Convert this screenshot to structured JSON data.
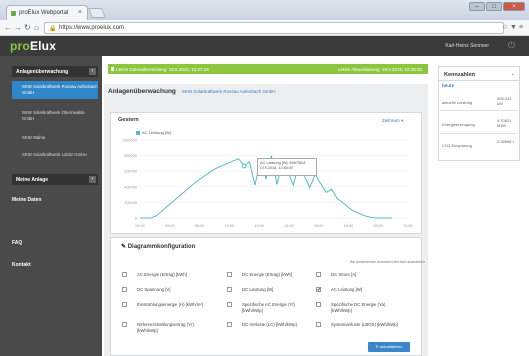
{
  "browser": {
    "tab_title": "proElux Webportal",
    "url": "https://www.proelux.com",
    "window_buttons": [
      "–",
      "□",
      "×"
    ]
  },
  "app": {
    "logo_pre": "pro",
    "logo_post": "Elux",
    "user": "Karl-Heinz Sonnner"
  },
  "sidebar": {
    "sections": [
      {
        "label": "Anlagenüberwachung",
        "toggle": "‹"
      },
      {
        "label": "Meine Anlage",
        "toggle": "›"
      },
      {
        "label": "Meine Daten"
      }
    ],
    "items": [
      {
        "label": "SKW Solarkraftwerk Rossau Aufenbach GmbH",
        "active": true
      },
      {
        "label": "SKW Solarkraftwerk Obernwalde GmbH"
      },
      {
        "label": "SKW Wahla"
      },
      {
        "label": "SKW Solarkraftwerk Lubitz GmbH"
      }
    ],
    "bottom": [
      "FAQ",
      "Kontakt"
    ]
  },
  "notification": {
    "left": "Letzte Datenübermittlung: 19.5.2015, 10:27:16",
    "right": "Letzte Aktualisierung: 19.5.2015, 10:48:30"
  },
  "page": {
    "title": "Anlagenüberwachung",
    "subtitle": "SKW Solarkraftwerk Rossau Aufenbach GmbH"
  },
  "chart_card": {
    "title": "Gestern",
    "zeitraum": "Zeitraum ▾",
    "tooltip_line1": "AC Leistung [W]: 668798.8",
    "tooltip_line2": "Di 5.2015, 12:50:00"
  },
  "chart_data": {
    "type": "line",
    "series": [
      {
        "name": "AC Leistung [W]",
        "color": "#5bb8c8"
      }
    ],
    "x": [
      "04:00",
      "06:00",
      "08:00",
      "10:00",
      "12:00",
      "14:00",
      "16:00",
      "18:00",
      "20:00",
      "22:00"
    ],
    "ylim": [
      0,
      1000000
    ],
    "yticks": [
      "0",
      "200000",
      "400000",
      "600000",
      "800000",
      "1000000"
    ],
    "values": [
      0,
      0,
      0,
      30000,
      90000,
      150000,
      210000,
      270000,
      330000,
      390000,
      450000,
      500000,
      550000,
      600000,
      640000,
      670000,
      700000,
      730000,
      760000,
      668798,
      720000,
      420000,
      760000,
      500000,
      800000,
      430000,
      710000,
      600000,
      420000,
      680000,
      540000,
      390000,
      560000,
      440000,
      330000,
      370000,
      250000,
      200000,
      140000,
      90000,
      60000,
      30000,
      10000,
      0,
      0,
      0,
      0
    ]
  },
  "config": {
    "title": "Diagrammkonfiguration",
    "hint": "Bei bestehender Auswahl mehrfach auswählen",
    "options": [
      {
        "label": "AC Energie (Ertrag) [kWh]",
        "checked": false
      },
      {
        "label": "DC Energie (Ertrag) [kWh]",
        "checked": false
      },
      {
        "label": "DC Strom [A]",
        "checked": false
      },
      {
        "label": "DC Spannung [V]",
        "checked": false
      },
      {
        "label": "DC Leistung [W]",
        "checked": false
      },
      {
        "label": "AC Leistung [W]",
        "checked": true
      },
      {
        "label": "Einstrahlungsenergie (H) [kWh/m²]",
        "checked": false
      },
      {
        "label": "Spezifische AC Energie (Yf) [kWh/kWp]",
        "checked": false
      },
      {
        "label": "Spezifische DC Energie (Ya) [kWh/kWp]",
        "checked": false
      },
      {
        "label": "Referenzstrahlungsertrag (Yr) [kWh/kWp]",
        "checked": false
      },
      {
        "label": "DC-Verluste (LC) [kWh/kWp]",
        "checked": false
      },
      {
        "label": "Systemverluste (LBOS) [kWh/kWp]",
        "checked": false
      }
    ],
    "apply_label": "↻ aktualisieren"
  },
  "kennzahlen": {
    "title": "Kennzahlen",
    "tab": "heute",
    "rows": [
      {
        "label": "aktuelle Leistung",
        "value": "398.432 kW"
      },
      {
        "label": "Energieerzeugung",
        "value": "4.70821 MWh"
      },
      {
        "label": "CO2-Einsparung",
        "value": "2.39988 t"
      }
    ]
  }
}
